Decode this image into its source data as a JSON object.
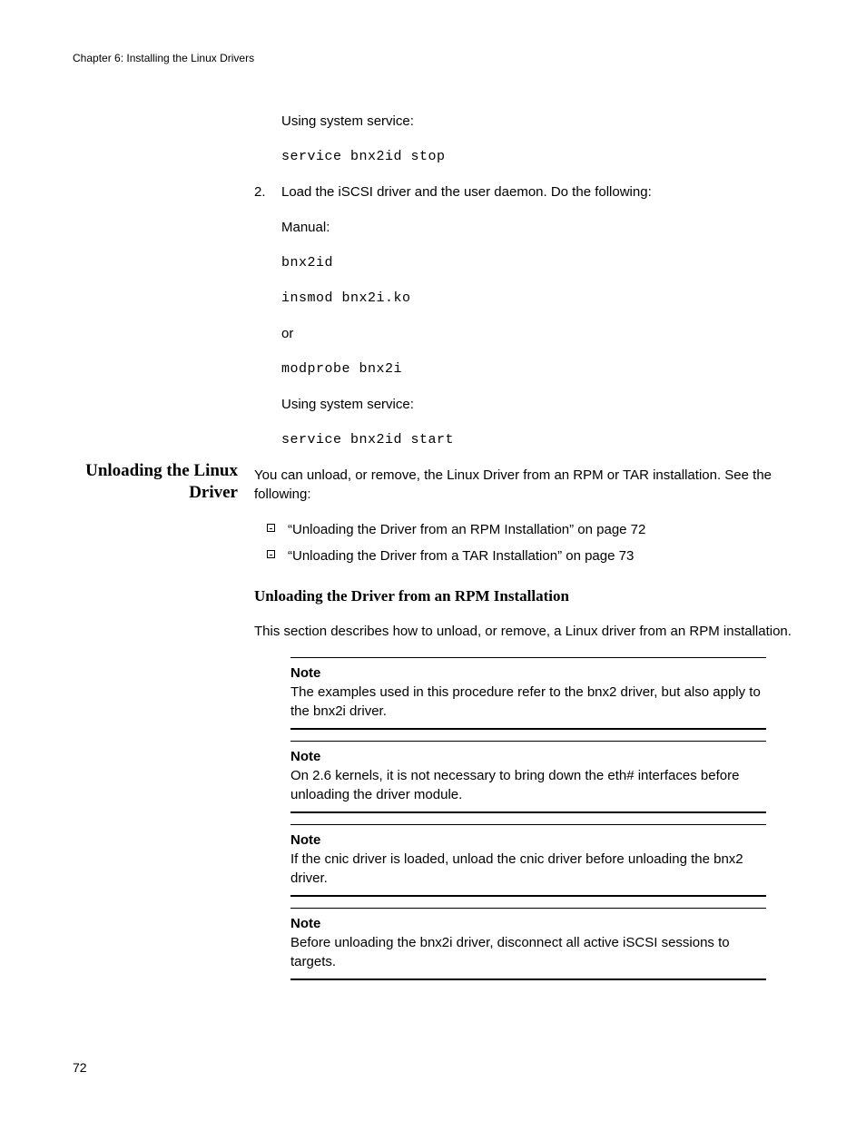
{
  "header": {
    "running": "Chapter 6: Installing the Linux Drivers"
  },
  "step1": {
    "line1": "Using system service:",
    "cmd1": "service bnx2id stop"
  },
  "step2": {
    "num": "2.",
    "intro": "Load the iSCSI driver and the user daemon. Do the following:",
    "line_manual": "Manual:",
    "cmd_a": "bnx2id",
    "cmd_b": "insmod bnx2i.ko",
    "or": "or",
    "cmd_c": "modprobe bnx2i",
    "line_sys": "Using system service:",
    "cmd_d": "service bnx2id start"
  },
  "section": {
    "heading": "Unloading the Linux Driver",
    "intro": "You can unload, or remove, the Linux Driver from an RPM or TAR installation. See the following:",
    "bullets": [
      "“Unloading the Driver from an RPM Installation” on page 72",
      "“Unloading the Driver from a TAR Installation” on page 73"
    ],
    "subhead": "Unloading the Driver from an RPM Installation",
    "desc": "This section describes how to unload, or remove, a Linux driver from an RPM installation."
  },
  "notes": {
    "label": "Note",
    "n1": "The examples used in this procedure refer to the bnx2 driver, but also apply to the bnx2i driver.",
    "n2": "On 2.6 kernels, it is not necessary to bring down the eth# interfaces before unloading the driver module.",
    "n3": "If the cnic driver is loaded, unload the cnic driver before unloading the bnx2 driver.",
    "n4": "Before unloading the bnx2i driver, disconnect all active iSCSI sessions to targets."
  },
  "footer": {
    "page": "72"
  }
}
